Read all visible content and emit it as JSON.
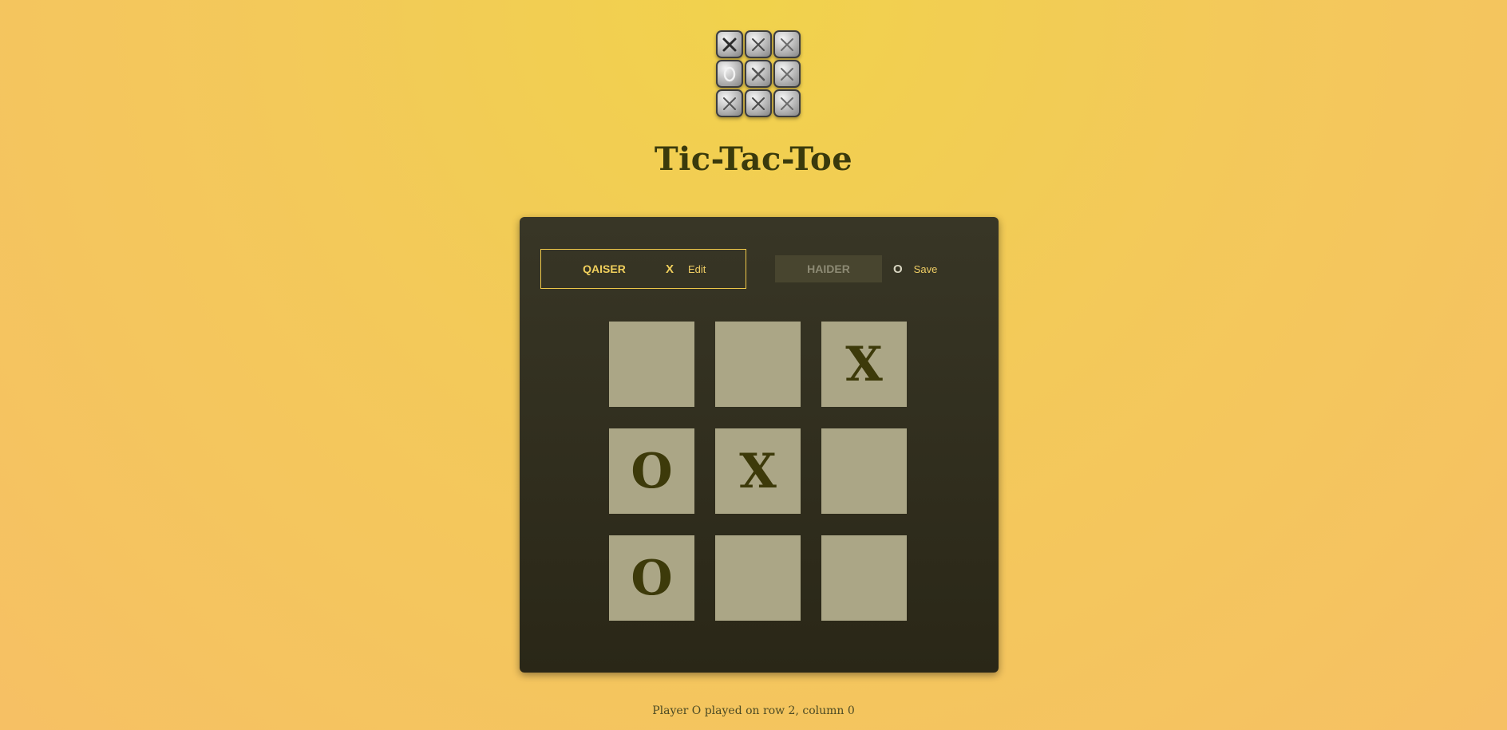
{
  "logo": {
    "tiles": [
      "x",
      "x",
      "x",
      "o",
      "x",
      "x",
      "x",
      "x",
      "x"
    ]
  },
  "title": "Tic-Tac-Toe",
  "players": [
    {
      "name": "QAISER",
      "symbol": "X",
      "button": "Edit",
      "active": true
    },
    {
      "name": "HAIDER",
      "symbol": "O",
      "button": "Save",
      "active": false
    }
  ],
  "board": [
    [
      "",
      "",
      "X"
    ],
    [
      "O",
      "X",
      ""
    ],
    [
      "O",
      "",
      ""
    ]
  ],
  "log": "Player O played on row 2, column 0",
  "colors": {
    "accent": "#f0cf5c",
    "panel": "#33301f",
    "cell": "#aba686",
    "mark": "#3d3a0a",
    "title": "#3a3a0c"
  }
}
